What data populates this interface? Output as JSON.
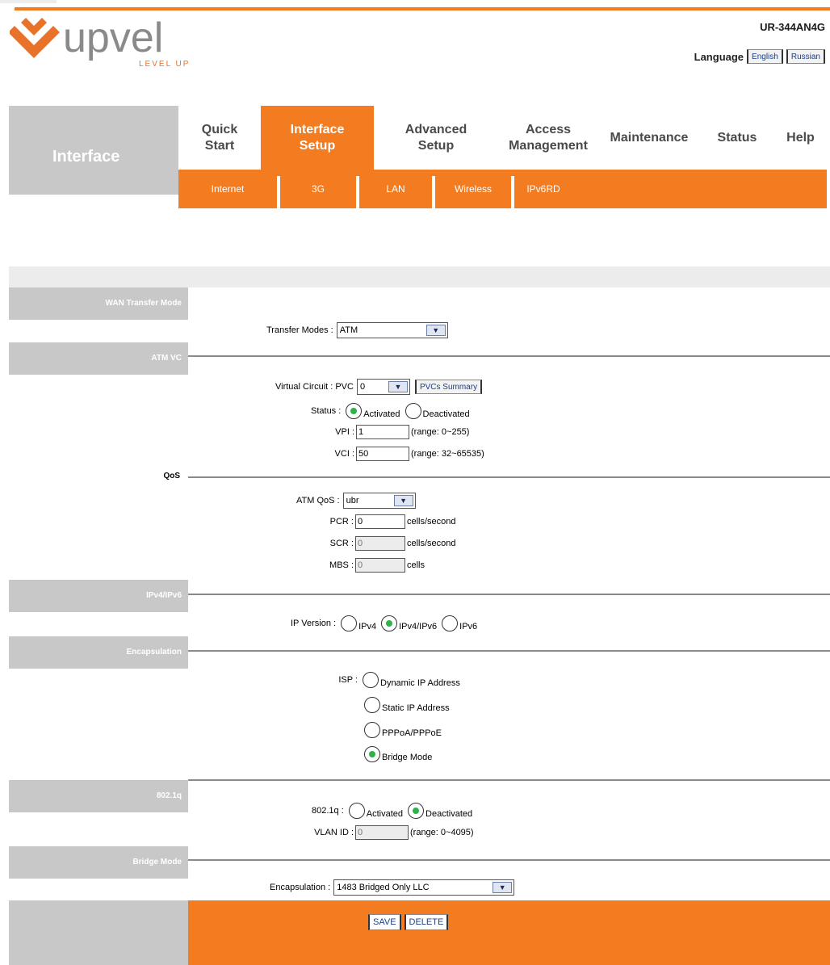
{
  "brand": {
    "logo_text": "upvel",
    "tagline": "LEVEL UP",
    "model": "UR-344AN4G",
    "accent": "#f37b20"
  },
  "language": {
    "label": "Language",
    "options": [
      "English",
      "Russian"
    ]
  },
  "section_title": "Interface",
  "main_nav": [
    {
      "line1": "Quick",
      "line2": "Start"
    },
    {
      "line1": "Interface",
      "line2": "Setup"
    },
    {
      "line1": "Advanced",
      "line2": "Setup"
    },
    {
      "line1": "Access",
      "line2": "Management"
    },
    {
      "line1": "Maintenance",
      "line2": ""
    },
    {
      "line1": "Status",
      "line2": ""
    },
    {
      "line1": "Help",
      "line2": ""
    }
  ],
  "sub_nav": [
    "Internet",
    "3G",
    "LAN",
    "Wireless",
    "IPv6RD"
  ],
  "sections": {
    "wan": "WAN Transfer Mode",
    "atm_vc": "ATM VC",
    "qos": "QoS",
    "ip": "IPv4/IPv6",
    "encap": "Encapsulation",
    "dot1q": "802.1q",
    "bridge": "Bridge Mode"
  },
  "transfer": {
    "label": "Transfer Modes :",
    "value": "ATM"
  },
  "vc": {
    "label": "Virtual Circuit :",
    "prefix": "PVC",
    "value": "0",
    "summary_btn": "PVCs Summary"
  },
  "status": {
    "label": "Status :",
    "activated": "Activated",
    "deactivated": "Deactivated"
  },
  "vpi": {
    "label": "VPI :",
    "value": "1",
    "hint": "(range: 0~255)"
  },
  "vci": {
    "label": "VCI :",
    "value": "50",
    "hint": "(range: 32~65535)"
  },
  "atm_qos": {
    "label": "ATM QoS :",
    "value": "ubr"
  },
  "pcr": {
    "label": "PCR :",
    "value": "0",
    "unit": "cells/second"
  },
  "scr": {
    "label": "SCR :",
    "value": "0",
    "unit": "cells/second"
  },
  "mbs": {
    "label": "MBS :",
    "value": "0",
    "unit": "cells"
  },
  "ip_version": {
    "label": "IP Version :",
    "opt1": "IPv4",
    "opt2": "IPv4/IPv6",
    "opt3": "IPv6"
  },
  "isp": {
    "label": "ISP :",
    "opt1": "Dynamic IP Address",
    "opt2": "Static IP Address",
    "opt3": "PPPoA/PPPoE",
    "opt4": "Bridge Mode"
  },
  "dot1q": {
    "label": "802.1q :",
    "activated": "Activated",
    "deactivated": "Deactivated"
  },
  "vlan": {
    "label": "VLAN ID :",
    "value": "0",
    "hint": "(range: 0~4095)"
  },
  "encapsulation": {
    "label": "Encapsulation :",
    "value": "1483 Bridged Only LLC"
  },
  "buttons": {
    "save": "SAVE",
    "delete": "DELETE"
  }
}
